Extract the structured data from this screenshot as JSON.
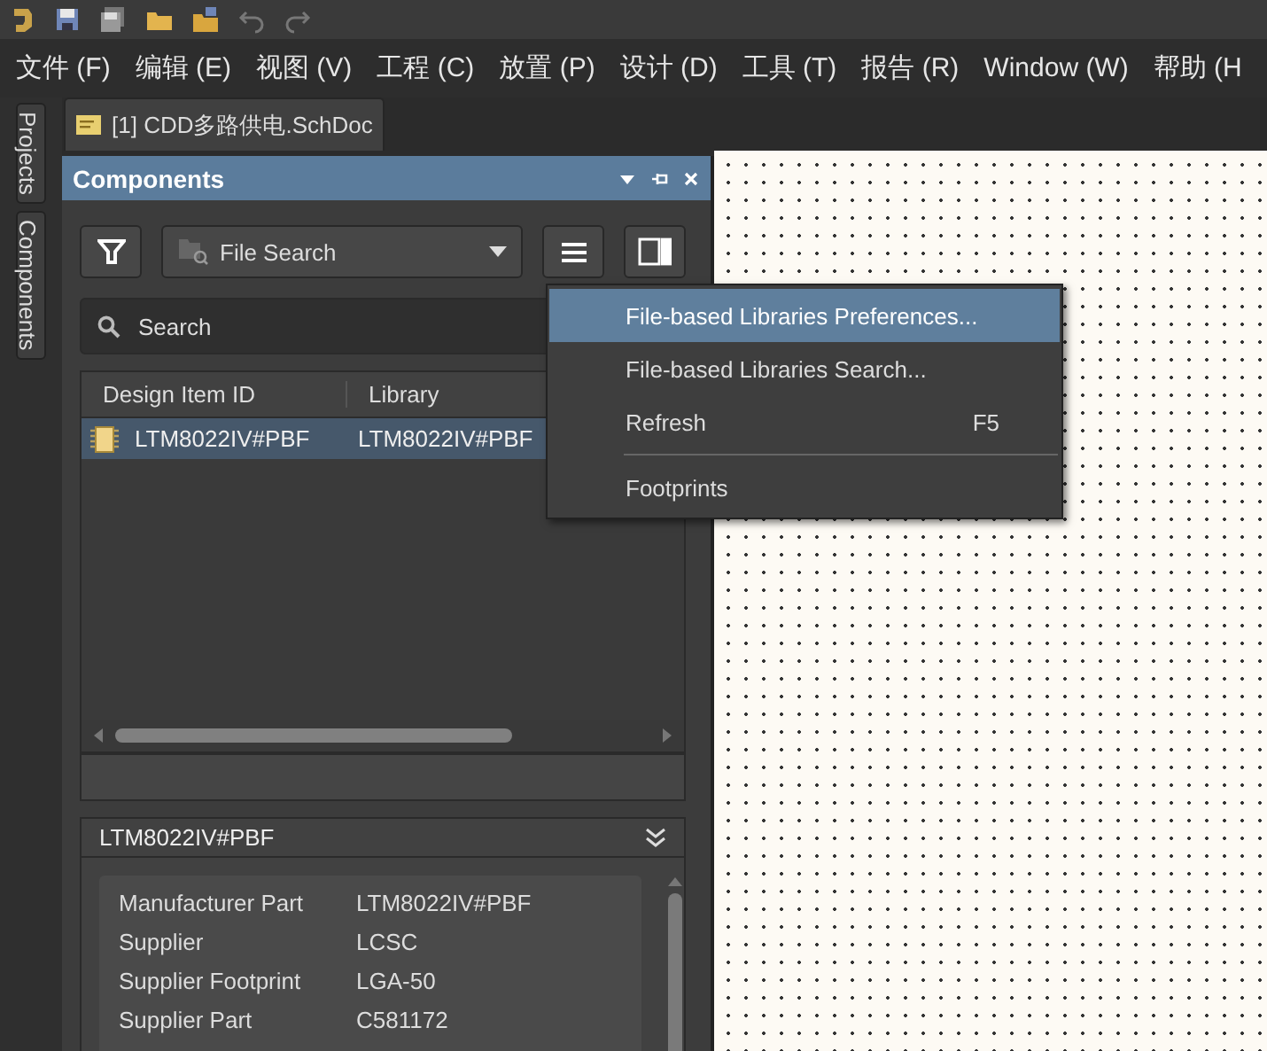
{
  "menu_bar": [
    {
      "label": "文件 (F)"
    },
    {
      "label": "编辑 (E)"
    },
    {
      "label": "视图 (V)"
    },
    {
      "label": "工程 (C)"
    },
    {
      "label": "放置 (P)"
    },
    {
      "label": "设计 (D)"
    },
    {
      "label": "工具 (T)"
    },
    {
      "label": "报告 (R)"
    },
    {
      "label": "Window (W)"
    },
    {
      "label": "帮助 (H"
    }
  ],
  "side_tabs": [
    {
      "label": "Projects"
    },
    {
      "label": "Components"
    }
  ],
  "document_tab": {
    "title": "[1] CDD多路供电.SchDoc"
  },
  "panel": {
    "title": "Components",
    "source_dropdown": {
      "value": "File Search"
    },
    "search": {
      "placeholder": "Search"
    },
    "table": {
      "columns": [
        "Design Item ID",
        "Library"
      ],
      "rows": [
        {
          "cells": [
            "LTM8022IV#PBF",
            "LTM8022IV#PBF"
          ],
          "selected": true
        }
      ]
    },
    "details": {
      "title": "LTM8022IV#PBF",
      "properties": [
        {
          "name": "Manufacturer Part",
          "value": "LTM8022IV#PBF"
        },
        {
          "name": "Supplier",
          "value": "LCSC"
        },
        {
          "name": "Supplier Footprint",
          "value": "LGA-50"
        },
        {
          "name": "Supplier Part",
          "value": "C581172"
        }
      ]
    }
  },
  "context_menu": {
    "items": [
      {
        "kind": "item",
        "label": "File-based Libraries Preferences...",
        "selected": true
      },
      {
        "kind": "item",
        "label": "File-based Libraries Search...",
        "selected": false
      },
      {
        "kind": "item",
        "label": "Refresh",
        "shortcut": "F5",
        "selected": false
      },
      {
        "kind": "separator"
      },
      {
        "kind": "item",
        "label": "Footprints",
        "selected": false
      }
    ]
  }
}
